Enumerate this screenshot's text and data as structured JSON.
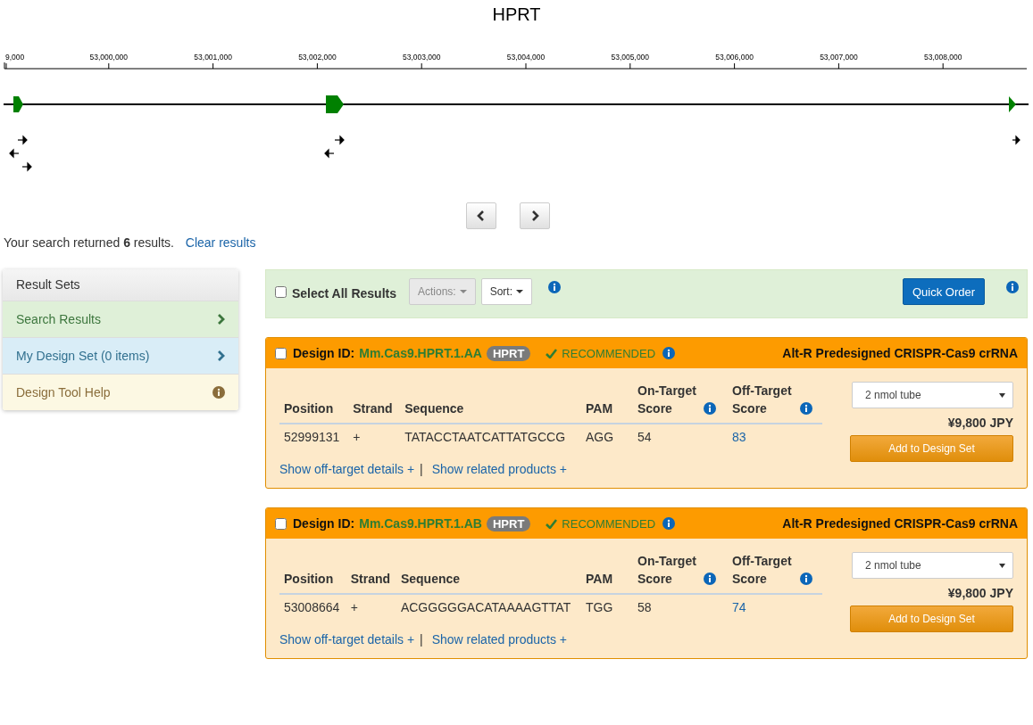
{
  "title": "HPRT",
  "axis": {
    "ticks": [
      "9,000",
      "53,000,000",
      "53,001,000",
      "53,002,000",
      "53,003,000",
      "53,004,000",
      "53,005,000",
      "53,006,000",
      "53,007,000",
      "53,008,000"
    ]
  },
  "summary": {
    "text": "Your search returned **6** results.",
    "clear_link": "Clear results"
  },
  "sidebar": {
    "header": "Result Sets",
    "items": [
      {
        "label": "Search Results",
        "kind": "success"
      },
      {
        "label": "My Design Set (0 items)",
        "kind": "info"
      },
      {
        "label": "Design Tool Help",
        "kind": "help"
      }
    ]
  },
  "toolbar": {
    "select_all": {
      "label": "Select All Results",
      "checked": false
    },
    "actions": {
      "label": "Actions:",
      "disabled": true
    },
    "sort": {
      "label": "Sort:",
      "disabled": false
    },
    "quick_order": "Quick Order"
  },
  "designs": [
    {
      "checked": false,
      "label": "Design ID:",
      "id": "Mm.Cas9.HPRT.1.AA",
      "gene": "HPRT",
      "status": "RECOMMENDED",
      "product": "Alt-R Predesigned CRISPR-Cas9 crRNA",
      "columns": [
        {
          "label": "Position",
          "info": false
        },
        {
          "label": "Strand",
          "info": false
        },
        {
          "label": "Sequence",
          "info": false
        },
        {
          "label": "PAM",
          "info": false
        },
        {
          "label": "On-Target Score",
          "info": true
        },
        {
          "label": "Off-Target Score",
          "info": true
        }
      ],
      "row": [
        "52999131",
        "+",
        "TATACCTAATCATTATGCCG",
        "AGG",
        "54",
        "83"
      ],
      "links": [
        "Show off-target details +",
        "Show related products +"
      ],
      "separator": "|",
      "option": "2 nmol tube",
      "price": "¥9,800 JPY",
      "add_button": "Add to Design Set"
    },
    {
      "checked": false,
      "label": "Design ID:",
      "id": "Mm.Cas9.HPRT.1.AB",
      "gene": "HPRT",
      "status": "RECOMMENDED",
      "product": "Alt-R Predesigned CRISPR-Cas9 crRNA",
      "columns": [
        {
          "label": "Position",
          "info": false
        },
        {
          "label": "Strand",
          "info": false
        },
        {
          "label": "Sequence",
          "info": false
        },
        {
          "label": "PAM",
          "info": false
        },
        {
          "label": "On-Target Score",
          "info": true
        },
        {
          "label": "Off-Target Score",
          "info": true
        }
      ],
      "row": [
        "53008664",
        "+",
        "ACGGGGGACATAAAAGTTAT",
        "TGG",
        "58",
        "74"
      ],
      "links": [
        "Show off-target details +",
        "Show related products +"
      ],
      "separator": "|",
      "option": "2 nmol tube",
      "price": "¥9,800 JPY",
      "add_button": "Add to Design Set"
    }
  ]
}
